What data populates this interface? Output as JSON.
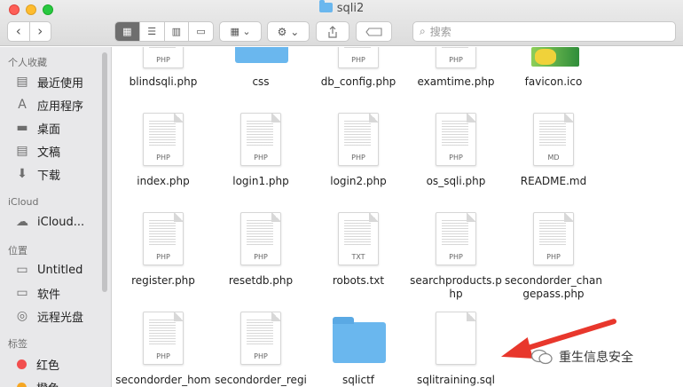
{
  "window": {
    "title": "sqli2"
  },
  "toolbar": {
    "back": "‹",
    "forward": "›",
    "view_modes": [
      "▦",
      "☰",
      "▥",
      "▭"
    ],
    "arrange": "▦ ⌄",
    "action": "⚙ ⌄",
    "search_placeholder": "搜索"
  },
  "sidebar": {
    "favorites_header": "个人收藏",
    "favorites": [
      {
        "label": "最近使用",
        "icon": "recents-icon",
        "glyph": "▤"
      },
      {
        "label": "应用程序",
        "icon": "applications-icon",
        "glyph": "A"
      },
      {
        "label": "桌面",
        "icon": "desktop-icon",
        "glyph": "▬"
      },
      {
        "label": "文稿",
        "icon": "documents-icon",
        "glyph": "▤"
      },
      {
        "label": "下载",
        "icon": "downloads-icon",
        "glyph": "⬇"
      }
    ],
    "icloud_header": "iCloud",
    "icloud": [
      {
        "label": "iCloud...",
        "icon": "cloud-icon",
        "glyph": "☁"
      }
    ],
    "locations_header": "位置",
    "locations": [
      {
        "label": "Untitled",
        "icon": "disk-icon",
        "glyph": "▭"
      },
      {
        "label": "软件",
        "icon": "disk-icon",
        "glyph": "▭"
      },
      {
        "label": "远程光盘",
        "icon": "disc-icon",
        "glyph": "◎"
      }
    ],
    "tags_header": "标签",
    "tags": [
      {
        "label": "红色",
        "color": "#f24e4e"
      },
      {
        "label": "橙色",
        "color": "#f5a623"
      }
    ]
  },
  "files": [
    {
      "name": "blindsqli.php",
      "kind": "doc",
      "ext": "PHP"
    },
    {
      "name": "css",
      "kind": "folder",
      "ext": ""
    },
    {
      "name": "db_config.php",
      "kind": "doc",
      "ext": "PHP"
    },
    {
      "name": "examtime.php",
      "kind": "doc",
      "ext": "PHP"
    },
    {
      "name": "favicon.ico",
      "kind": "image",
      "ext": ""
    },
    {
      "name": "index.php",
      "kind": "doc",
      "ext": "PHP"
    },
    {
      "name": "login1.php",
      "kind": "doc",
      "ext": "PHP"
    },
    {
      "name": "login2.php",
      "kind": "doc",
      "ext": "PHP"
    },
    {
      "name": "os_sqli.php",
      "kind": "doc",
      "ext": "PHP"
    },
    {
      "name": "README.md",
      "kind": "doc",
      "ext": "MD"
    },
    {
      "name": "register.php",
      "kind": "doc",
      "ext": "PHP"
    },
    {
      "name": "resetdb.php",
      "kind": "doc",
      "ext": "PHP"
    },
    {
      "name": "robots.txt",
      "kind": "doc",
      "ext": "TXT"
    },
    {
      "name": "searchproducts.p\nhp",
      "kind": "doc",
      "ext": "PHP"
    },
    {
      "name": "secondorder_chan\ngepass.php",
      "kind": "doc",
      "ext": "PHP"
    },
    {
      "name": "secondorder_hom",
      "kind": "doc",
      "ext": "PHP"
    },
    {
      "name": "secondorder_regi",
      "kind": "doc",
      "ext": "PHP"
    },
    {
      "name": "sqlictf",
      "kind": "folder",
      "ext": ""
    },
    {
      "name": "sqlitraining.sql",
      "kind": "blank",
      "ext": ""
    }
  ],
  "annotation": {
    "arrow_color": "#e8372c"
  },
  "watermark": {
    "text": "重生信息安全"
  }
}
